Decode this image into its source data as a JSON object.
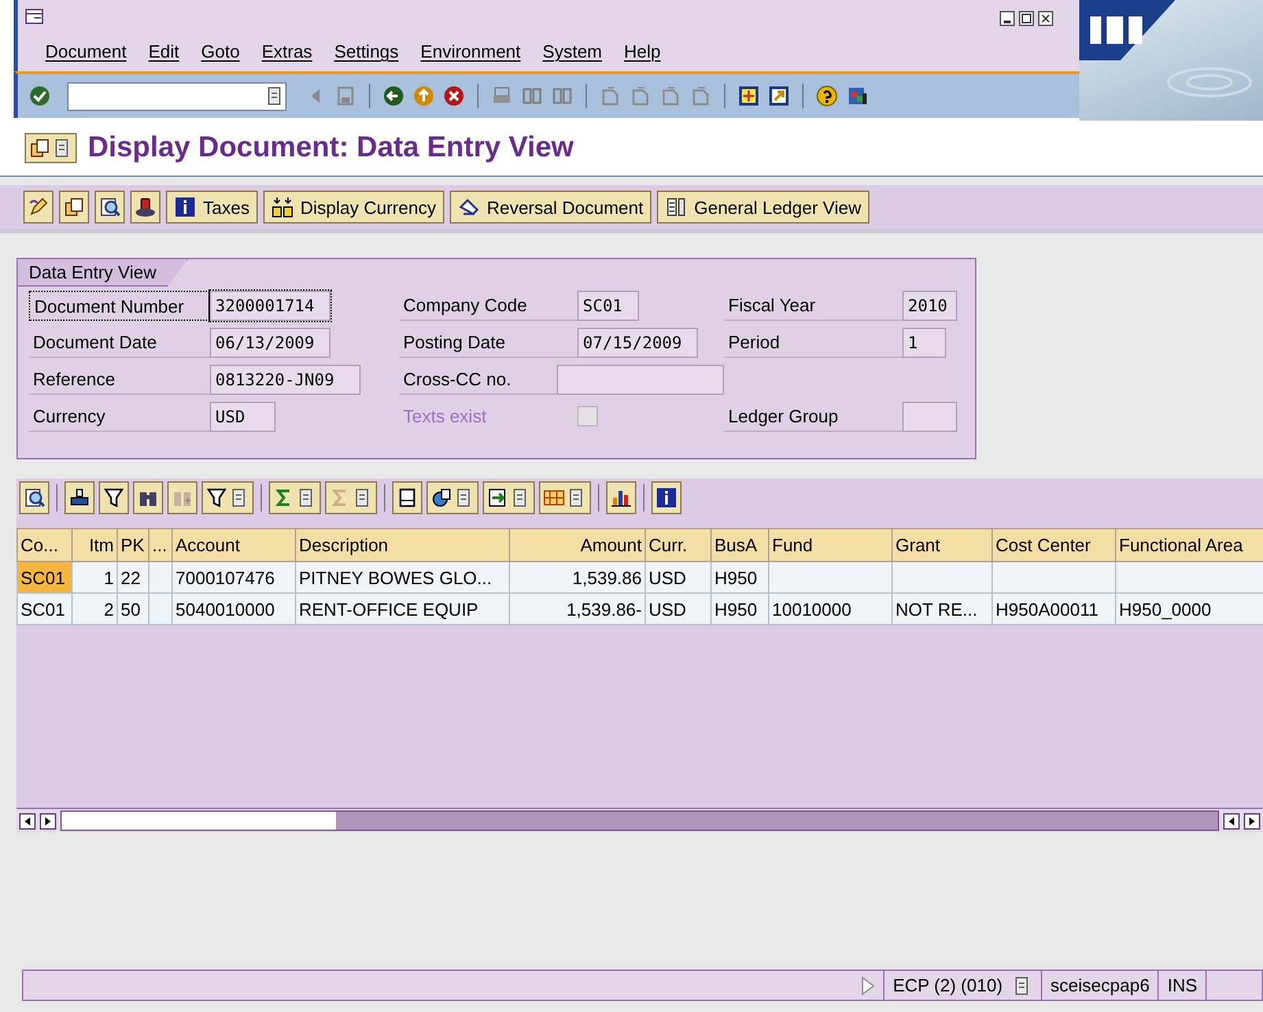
{
  "menu": [
    "Document",
    "Edit",
    "Goto",
    "Extras",
    "Settings",
    "Environment",
    "System",
    "Help"
  ],
  "title": "Display Document: Data Entry View",
  "app_toolbar": {
    "buttons": [
      {
        "label": "Taxes",
        "kind": "info"
      },
      {
        "label": "Display Currency",
        "kind": "currency"
      },
      {
        "label": "Reversal Document",
        "kind": "reverse"
      },
      {
        "label": "General Ledger View",
        "kind": "ledger"
      }
    ]
  },
  "form": {
    "title": "Data Entry View",
    "rows": [
      [
        {
          "label": "Document Number",
          "value": "3200001714",
          "kind": "input",
          "focused": true
        },
        {
          "label": "Company Code",
          "value": "SC01",
          "kind": "input",
          "focused": false
        },
        {
          "label": "Fiscal Year",
          "value": "2010",
          "kind": "input",
          "focused": false
        }
      ],
      [
        {
          "label": "Document Date",
          "value": "06/13/2009",
          "kind": "input",
          "focused": false
        },
        {
          "label": "Posting Date",
          "value": "07/15/2009",
          "kind": "input",
          "focused": false
        },
        {
          "label": "Period",
          "value": "1",
          "kind": "input",
          "focused": false
        }
      ],
      [
        {
          "label": "Reference",
          "value": "0813220-JN09",
          "kind": "input",
          "focused": false
        },
        {
          "label": "Cross-CC no.",
          "kind": "input",
          "focused": false
        }
      ],
      [
        {
          "label": "Currency",
          "value": "USD",
          "kind": "input",
          "focused": false
        },
        {
          "label": "Texts exist",
          "kind": "checkbox",
          "checked": false,
          "disabled": true
        },
        {
          "label": "Ledger Group",
          "kind": "input",
          "focused": false
        }
      ]
    ]
  },
  "table": {
    "columns": [
      {
        "label": "Co...",
        "numeric": false
      },
      {
        "label": "Itm",
        "numeric": true
      },
      {
        "label": "PK",
        "numeric": false
      },
      {
        "label": "...",
        "numeric": false
      },
      {
        "label": "Account",
        "numeric": false
      },
      {
        "label": "Description",
        "numeric": false
      },
      {
        "label": "Amount",
        "numeric": true
      },
      {
        "label": "Curr.",
        "numeric": false
      },
      {
        "label": "BusA",
        "numeric": false
      },
      {
        "label": "Fund",
        "numeric": false
      },
      {
        "label": "Grant",
        "numeric": false
      },
      {
        "label": "Cost Center",
        "numeric": false
      },
      {
        "label": "Functional Area",
        "numeric": false
      }
    ],
    "rows": [
      {
        "cursor": true,
        "cells": [
          "SC01",
          "1",
          "22",
          "",
          "7000107476",
          "PITNEY BOWES GLO...",
          "1,539.86",
          "USD",
          "H950",
          "",
          "",
          "",
          ""
        ]
      },
      {
        "cursor": false,
        "cells": [
          "SC01",
          "2",
          "50",
          "",
          "5040010000",
          "RENT-OFFICE EQUIP",
          "1,539.86-",
          "USD",
          "H950",
          "10010000",
          "NOT RE...",
          "H950A00011",
          "H950_0000"
        ]
      }
    ]
  },
  "status_bar": {
    "system": "ECP (2) (010)",
    "server": "sceisecpap6",
    "mode": "INS"
  }
}
